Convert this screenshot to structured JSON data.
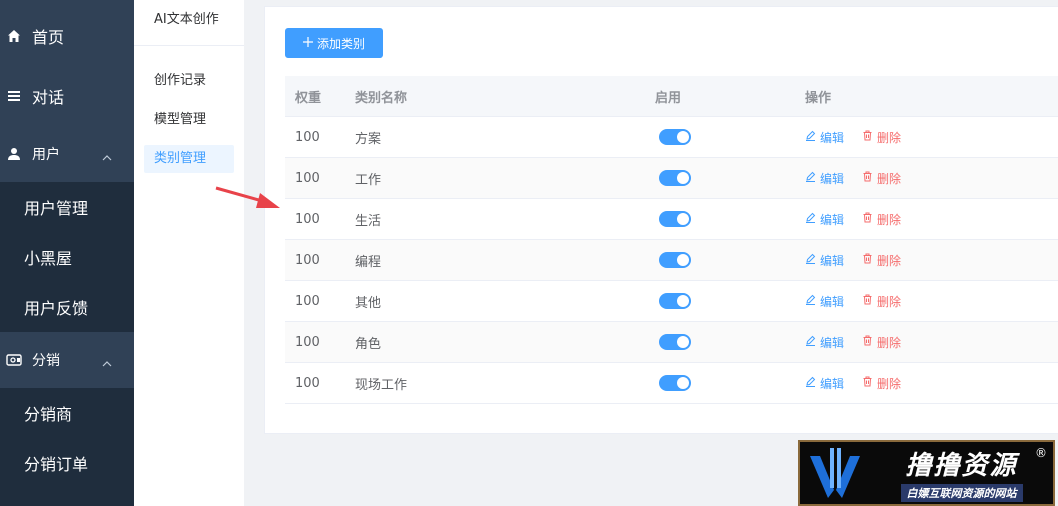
{
  "sidebar": {
    "home": "首页",
    "chat": "对话",
    "users": {
      "label": "用户",
      "items": [
        "用户管理",
        "小黑屋",
        "用户反馈"
      ]
    },
    "distribution": {
      "label": "分销",
      "items": [
        "分销商",
        "分销订单"
      ]
    }
  },
  "submenu": {
    "title": "AI文本创作",
    "items": [
      "创作记录",
      "模型管理",
      "类别管理"
    ],
    "active_index": 2
  },
  "main": {
    "add_button": "添加类别",
    "table": {
      "headers": [
        "权重",
        "类别名称",
        "启用",
        "操作"
      ],
      "rows": [
        {
          "weight": "100",
          "name": "方案",
          "enabled": true
        },
        {
          "weight": "100",
          "name": "工作",
          "enabled": true
        },
        {
          "weight": "100",
          "name": "生活",
          "enabled": true
        },
        {
          "weight": "100",
          "name": "编程",
          "enabled": true
        },
        {
          "weight": "100",
          "name": "其他",
          "enabled": true
        },
        {
          "weight": "100",
          "name": "角色",
          "enabled": true
        },
        {
          "weight": "100",
          "name": "现场工作",
          "enabled": true
        }
      ],
      "edit_label": "编辑",
      "delete_label": "删除"
    }
  },
  "watermark": {
    "title": "撸撸资源",
    "subtitle": "白嫖互联网资源的网站",
    "mark": "®"
  },
  "colors": {
    "sidebar_bg": "#304156",
    "sidebar_sub_bg": "#1f2d3d",
    "primary": "#409eff",
    "danger": "#f56c6c",
    "arrow": "#e8434a"
  }
}
